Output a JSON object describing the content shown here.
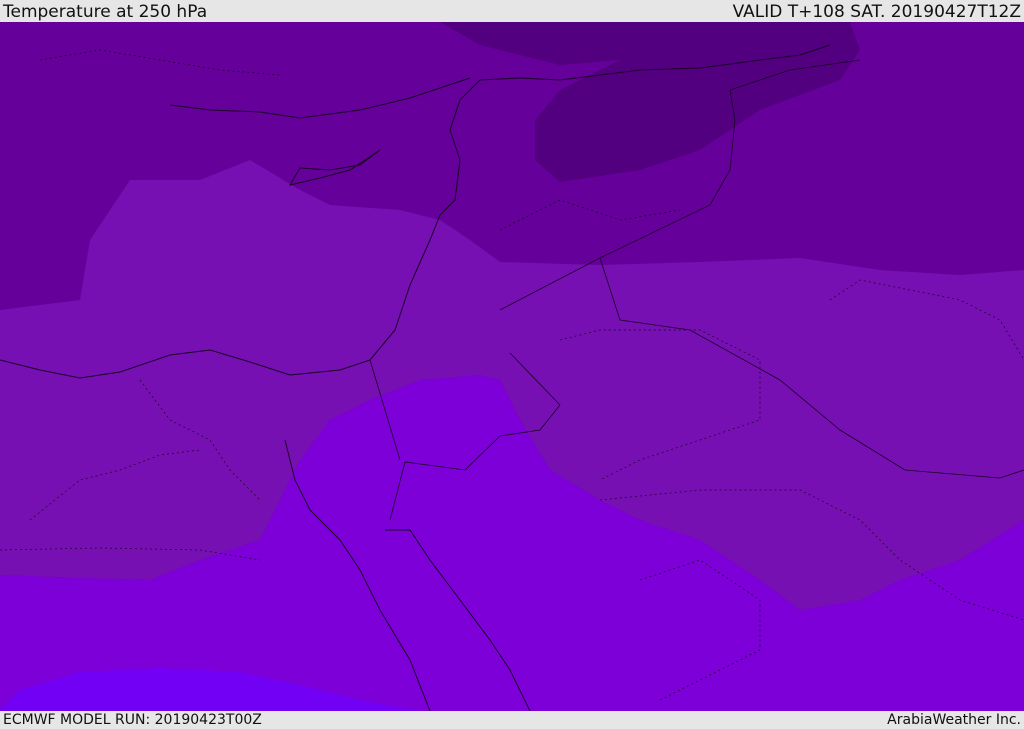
{
  "header": {
    "title": "Temperature at 250 hPa",
    "valid": "VALID T+108 SAT. 20190427T12Z"
  },
  "footer": {
    "model_run": "ECMWF MODEL RUN: 20190423T00Z",
    "credit": "ArabiaWeather Inc."
  },
  "map": {
    "field": "temperature",
    "level": "250 hPa",
    "colors": {
      "darkest": "#52007f",
      "dark": "#5e0090",
      "mid_dark": "#6a009c",
      "mid": "#7710b3",
      "bright": "#7d00d9",
      "brightest": "#7200f5",
      "border": "#1a0026"
    }
  }
}
